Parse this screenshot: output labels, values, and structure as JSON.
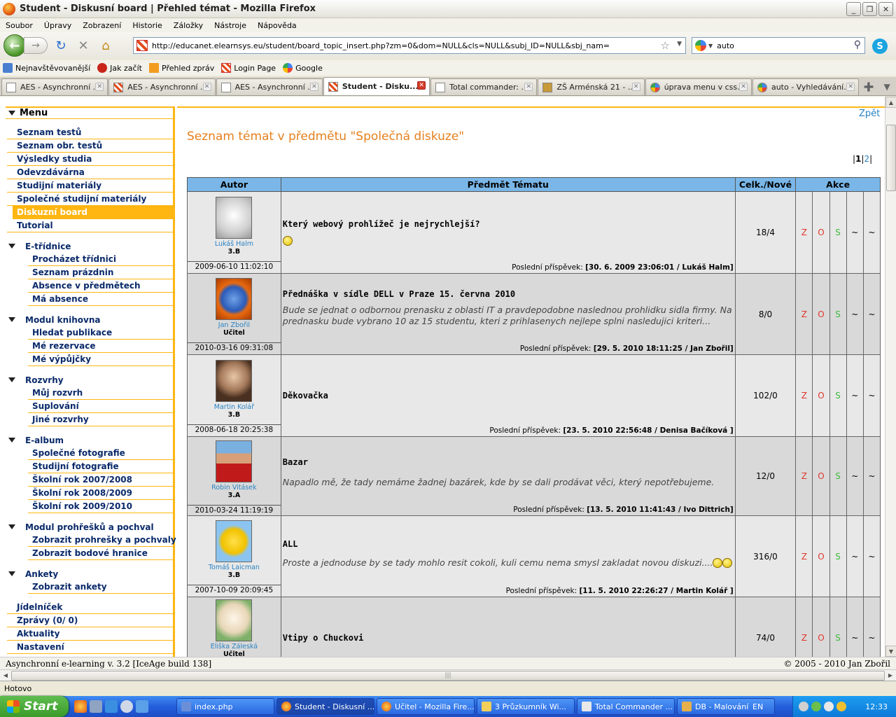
{
  "window": {
    "title": "Student - Diskusní board | Přehled témat - Mozilla Firefox",
    "buttons": {
      "minimize": "_",
      "maximize": "❐",
      "close": "✕"
    }
  },
  "menubar": [
    "Soubor",
    "Úpravy",
    "Zobrazení",
    "Historie",
    "Záložky",
    "Nástroje",
    "Nápověda"
  ],
  "navbar": {
    "url": "http://educanet.elearnsys.eu/student/board_topic_insert.php?zm=0&dom=NULL&cls=NULL&subj_ID=NULL&sbj_nam=",
    "search_value": "auto"
  },
  "bookmarks": [
    "Nejnavštěvovanější",
    "Jak začít",
    "Přehled zpráv",
    "Login Page",
    "Google"
  ],
  "tabs": [
    {
      "label": "AES - Asynchronní ..."
    },
    {
      "label": "AES - Asynchronní ..."
    },
    {
      "label": "AES - Asynchronní ..."
    },
    {
      "label": "Student - Disku..."
    },
    {
      "label": "Total commander: ..."
    },
    {
      "label": "ZŠ Arménská 21 - ..."
    },
    {
      "label": "úprava menu v css..."
    },
    {
      "label": "auto - Vyhledávání..."
    }
  ],
  "sidebar": {
    "header": "Menu",
    "top_items": [
      "Seznam testů",
      "Seznam obr. testů",
      "Výsledky studia",
      "Odevzdávárna",
      "Studijní materiály",
      "Společné studijní materiály",
      "Diskuzní board",
      "Tutorial"
    ],
    "groups": [
      {
        "title": "E-třídnice",
        "items": [
          "Procházet třídnici",
          "Seznam prázdnin",
          "Absence v předmětech",
          "Má absence"
        ]
      },
      {
        "title": "Modul knihovna",
        "items": [
          "Hledat publikace",
          "Mé rezervace",
          "Mé výpůjčky"
        ]
      },
      {
        "title": "Rozvrhy",
        "items": [
          "Můj rozvrh",
          "Suplování",
          "Jiné rozvrhy"
        ]
      },
      {
        "title": "E-album",
        "items": [
          "Společné fotografie",
          "Studijní fotografie",
          "Školní rok 2007/2008",
          "Školní rok 2008/2009",
          "Školní rok 2009/2010"
        ]
      },
      {
        "title": "Modul prohřešků a pochval",
        "items": [
          "Zobrazit prohrešky a pochvaly",
          "Zobrazit bodové hranice"
        ]
      },
      {
        "title": "Ankety",
        "items": [
          "Zobrazit ankety"
        ]
      }
    ],
    "bottom_items": [
      "Jídelníček",
      "Zprávy (0/ 0)",
      "Aktuality",
      "Nastavení"
    ]
  },
  "main": {
    "back_link": "Zpět",
    "heading": "Seznam témat v předmětu \"Společná diskuze\"",
    "pager": {
      "page1": "1",
      "page2": "2"
    },
    "columns": {
      "author": "Autor",
      "subject": "Předmět Tématu",
      "count": "Celk./Nové",
      "actions": "Akce"
    },
    "action_labels": {
      "z": "Z",
      "o": "O",
      "s": "S",
      "t1": "~",
      "t2": "~"
    },
    "last_post_label": "Poslední příspěvek:",
    "topics": [
      {
        "author": "Lukáš Halm",
        "class": "3.B",
        "date": "2009-06-10 11:02:10",
        "title": "Který webový prohlížeč je nejrychlejší?",
        "text": "",
        "count": "18/4",
        "last_post": "[30. 6. 2009 23:06:01 / Lukáš Halm]"
      },
      {
        "author": "Jan Zbořil",
        "class": "Učitel",
        "date": "2010-03-16 09:31:08",
        "title": "Přednáška v sídle DELL v Praze 15. června 2010",
        "text": "Bude se jednat o odbornou prenasku z oblasti IT a pravdepodobne naslednou prohlidku sidla firmy. Na prednasku bude vybrano 10 az 15 studentu, kteri z prihlasenych nejlepe splni nasledujici kriteri...",
        "count": "8/0",
        "last_post": "[29. 5. 2010 18:11:25 / Jan Zbořil]"
      },
      {
        "author": "Martin Kolář",
        "class": "3.B",
        "date": "2008-06-18 20:25:38",
        "title": "Děkovačka",
        "text": "",
        "count": "102/0",
        "last_post": "[23. 5. 2010 22:56:48 / Denisa Bačíková ]"
      },
      {
        "author": "Robin Vitásek",
        "class": "3.A",
        "date": "2010-03-24 11:19:19",
        "title": "Bazar",
        "text": "Napadlo mě, že tady nemáme žadnej bazárek, kde by se dali prodávat věci, který nepotřebujeme.",
        "count": "12/0",
        "last_post": "[13. 5. 2010 11:41:43 / Ivo Dittrich]"
      },
      {
        "author": "Tomáš Laicman",
        "class": "3.B",
        "date": "2007-10-09 20:09:45",
        "title": "ALL",
        "text": "Proste a jednoduse by se tady mohlo resit cokoli, kuli cemu nema smysl zakladat novou diskuzi....",
        "count": "316/0",
        "last_post": "[11. 5. 2010 22:26:27 / Martin Kolář ]"
      },
      {
        "author": "Eliška Záleská",
        "class": "Učitel",
        "date": "",
        "title": "Vtipy o Chuckovi",
        "text": "",
        "count": "74/0",
        "last_post": ""
      }
    ]
  },
  "footer": {
    "left": "Asynchronní e-learning v. 3.2 [IceAge build 138]",
    "right": "© 2005 - 2010 Jan Zbořil"
  },
  "statusbar": "Hotovo",
  "taskbar": {
    "start": "Start",
    "tasks": [
      "index.php",
      "Student - Diskusní ...",
      "Učitel - Mozilla Fire...",
      "3 Průzkumník Wi...",
      "Total Commander ...",
      "DB - Malování"
    ],
    "lang": "EN",
    "clock": "12:33"
  }
}
